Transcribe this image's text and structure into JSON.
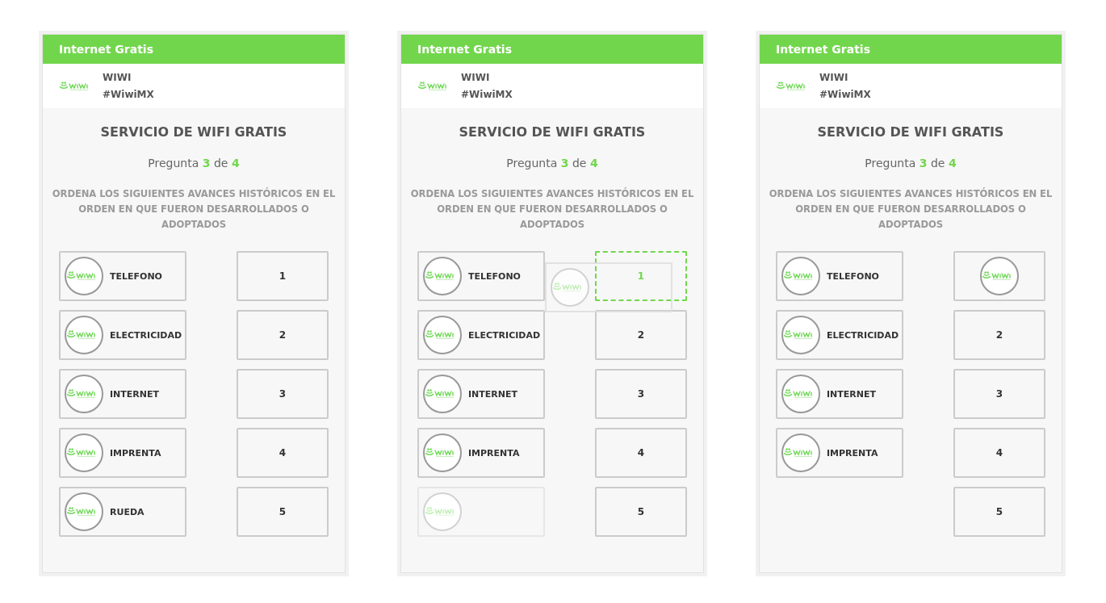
{
  "panels": [
    {
      "header_title": "Internet Gratis",
      "brand": {
        "name": "WIWI",
        "tag": "#WiwiMX"
      },
      "heading": "SERVICIO DE WIFI GRATIS",
      "progress": "Pregunta **3** de **4**",
      "instruction": "ORDENA LOS SIGUIENTES AVANCES HISTÓRICOS EN EL ORDEN EN QUE FUERON DESARROLLADOS O ADOPTADOS",
      "dragging": false,
      "items": [
        {
          "kind": "card",
          "label": "TELEFONO"
        },
        {
          "kind": "card",
          "label": "ELECTRICIDAD"
        },
        {
          "kind": "card",
          "label": "INTERNET"
        },
        {
          "kind": "card",
          "label": "IMPRENTA"
        },
        {
          "kind": "card",
          "label": "RUEDA"
        }
      ],
      "slots": [
        {
          "label": "1",
          "filled": false,
          "highlighted": false
        },
        {
          "label": "2",
          "filled": false,
          "highlighted": false
        },
        {
          "label": "3",
          "filled": false,
          "highlighted": false
        },
        {
          "label": "4",
          "filled": false,
          "highlighted": false
        },
        {
          "label": "5",
          "filled": false,
          "highlighted": false
        }
      ]
    },
    {
      "header_title": "Internet Gratis",
      "brand": {
        "name": "WIWI",
        "tag": "#WiwiMX"
      },
      "heading": "SERVICIO DE WIFI GRATIS",
      "progress": "Pregunta **3** de **4**",
      "instruction": "ORDENA LOS SIGUIENTES AVANCES HISTÓRICOS EN EL ORDEN EN QUE FUERON DESARROLLADOS O ADOPTADOS",
      "dragging": true,
      "items": [
        {
          "kind": "card",
          "label": "TELEFONO"
        },
        {
          "kind": "card",
          "label": "ELECTRICIDAD"
        },
        {
          "kind": "card",
          "label": "INTERNET"
        },
        {
          "kind": "card",
          "label": "IMPRENTA"
        },
        {
          "kind": "placeholder"
        }
      ],
      "slots": [
        {
          "label": "1",
          "filled": false,
          "highlighted": true
        },
        {
          "label": "2",
          "filled": false,
          "highlighted": false
        },
        {
          "label": "3",
          "filled": false,
          "highlighted": false
        },
        {
          "label": "4",
          "filled": false,
          "highlighted": false
        },
        {
          "label": "5",
          "filled": false,
          "highlighted": false
        }
      ]
    },
    {
      "header_title": "Internet Gratis",
      "brand": {
        "name": "WIWI",
        "tag": "#WiwiMX"
      },
      "heading": "SERVICIO DE WIFI GRATIS",
      "progress": "Pregunta **3** de **4**",
      "instruction": "ORDENA LOS SIGUIENTES AVANCES HISTÓRICOS EN EL ORDEN EN QUE FUERON DESARROLLADOS O ADOPTADOS",
      "dragging": false,
      "items": [
        {
          "kind": "card",
          "label": "TELEFONO"
        },
        {
          "kind": "card",
          "label": "ELECTRICIDAD"
        },
        {
          "kind": "card",
          "label": "INTERNET"
        },
        {
          "kind": "card",
          "label": "IMPRENTA"
        }
      ],
      "slots": [
        {
          "filled": true,
          "highlighted": false
        },
        {
          "label": "2",
          "filled": false,
          "highlighted": false
        },
        {
          "label": "3",
          "filled": false,
          "highlighted": false
        },
        {
          "label": "4",
          "filled": false,
          "highlighted": false
        },
        {
          "label": "5",
          "filled": false,
          "highlighted": false
        }
      ]
    }
  ]
}
